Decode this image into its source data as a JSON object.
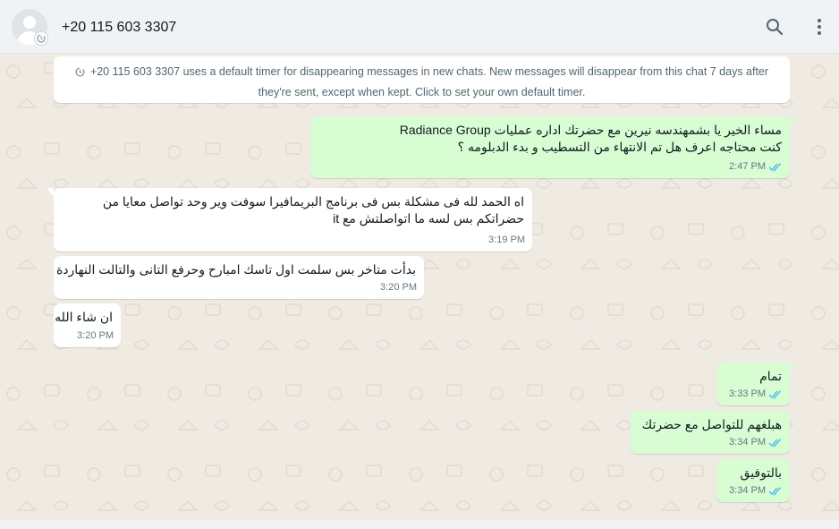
{
  "header": {
    "contact_name": "+20 115 603 3307",
    "icons": {
      "avatar": "default-avatar",
      "timer": "disappearing-timer-icon",
      "search": "search-icon",
      "menu": "kebab-menu-icon"
    }
  },
  "system_notice": {
    "line1": "+20 115 603 3307 uses a default timer for disappearing messages in new chats. New messages will disappear from this chat 7 days after",
    "line2": "they're sent, except when kept. Click to set your own default timer."
  },
  "colors": {
    "incoming": "#ffffff",
    "outgoing": "#d9fdd3",
    "tick_read": "#53bdeb",
    "header_bg": "#f0f2f5",
    "chat_bg": "#efeae2"
  },
  "messages": [
    {
      "direction": "out",
      "lines": [
        "مساء الخير يا بشمهندسه نيرين مع حضرتك اداره عمليات Radiance Group",
        "كنت محتاجه اعرف هل تم الانتهاء من التسطيب و بدء الدبلومه  ؟"
      ],
      "time": "2:47 PM",
      "status": "read"
    },
    {
      "direction": "in",
      "lines": [
        "اه الحمد لله فى مشكلة بس فى برنامج البريمافيرا سوفت وير وحد تواصل معايا من",
        "حضراتكم بس لسه ما اتواصلتش مع it"
      ],
      "time": "3:19 PM"
    },
    {
      "direction": "in",
      "lines": [
        "بدأت متاخر بس سلمت اول تاسك امبارح وحرفع التانى والتالت النهاردة"
      ],
      "time": "3:20 PM"
    },
    {
      "direction": "in",
      "lines": [
        "ان شاء الله"
      ],
      "time": "3:20 PM"
    },
    {
      "direction": "out",
      "lines": [
        "تمام"
      ],
      "time": "3:33 PM",
      "status": "read"
    },
    {
      "direction": "out",
      "lines": [
        "هبلغهم للتواصل مع حضرتك"
      ],
      "time": "3:34 PM",
      "status": "read"
    },
    {
      "direction": "out",
      "lines": [
        "بالتوفيق"
      ],
      "time": "3:34 PM",
      "status": "read"
    }
  ]
}
